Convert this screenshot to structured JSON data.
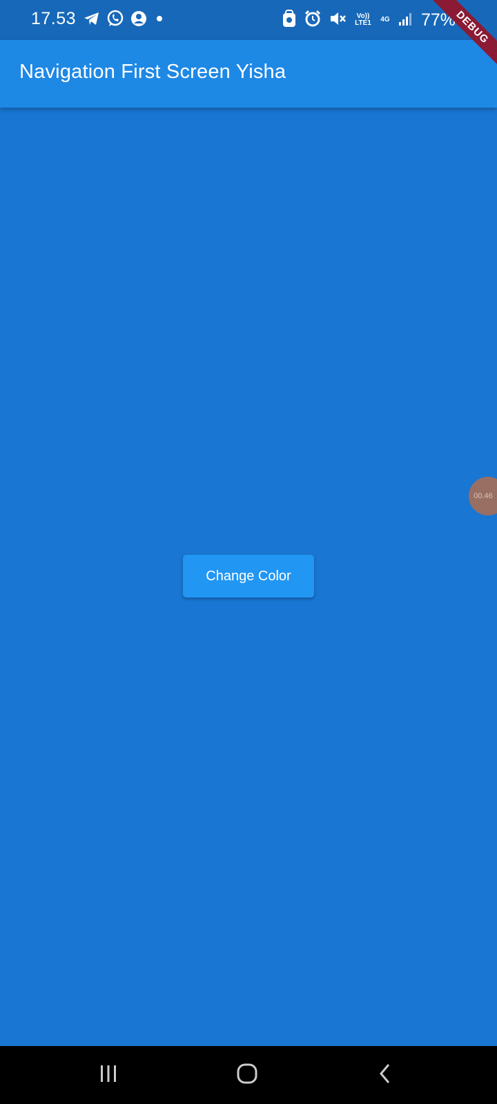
{
  "status_bar": {
    "time": "17.53",
    "left_icons": [
      "telegram-icon",
      "whatsapp-icon",
      "account-icon",
      "notification-dot-icon"
    ],
    "right_icons": [
      "security-icon",
      "alarm-icon",
      "mute-icon",
      "volte-icon",
      "4g-icon",
      "signal-icon"
    ],
    "volte_label": "Vo)) LTE1",
    "network_label": "4G",
    "battery": "77%"
  },
  "debug_banner": "DEBUG",
  "app_bar": {
    "title": "Navigation First Screen Yisha",
    "color": "#1E88E5"
  },
  "content": {
    "background_color": "#1976D2",
    "button_label": "Change Color",
    "button_color": "#2196F3"
  },
  "floating_timer": "00.46",
  "nav_bar": {
    "buttons": [
      "recent-apps-icon",
      "home-icon",
      "back-icon"
    ]
  }
}
